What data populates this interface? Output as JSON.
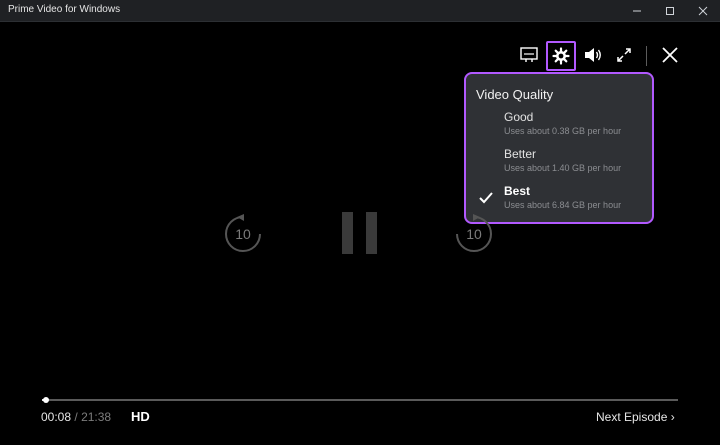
{
  "window": {
    "title": "Prime Video for Windows",
    "controls": [
      "minimize-icon",
      "maximize-icon",
      "close-icon"
    ]
  },
  "player": {
    "top_controls": {
      "icons": [
        "subtitles-icon",
        "settings-gear-icon",
        "volume-icon",
        "fullscreen-icon",
        "close-icon"
      ],
      "accent_color": "#b259ff"
    },
    "quality_menu": {
      "title": "Video Quality",
      "options": [
        {
          "label": "Good",
          "description": "Uses about 0.38 GB per hour",
          "selected": false
        },
        {
          "label": "Better",
          "description": "Uses about 1.40 GB per hour",
          "selected": false
        },
        {
          "label": "Best",
          "description": "Uses about 6.84 GB per hour",
          "selected": true
        }
      ]
    },
    "center_controls": {
      "rewind_seconds": "10",
      "forward_seconds": "10",
      "state": "pause-icon"
    },
    "progress": {
      "current_time": "00:08",
      "separator": "/",
      "total_time": "21:38",
      "fraction": 0.006
    },
    "quality_badge": "HD",
    "next_episode": "Next Episode ›"
  }
}
